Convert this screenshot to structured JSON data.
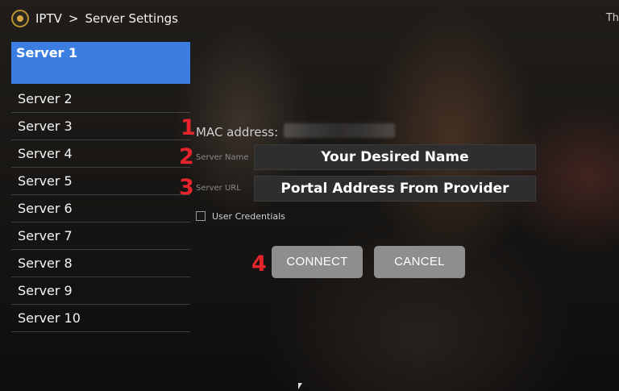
{
  "breadcrumb": {
    "app": "IPTV",
    "separator": ">",
    "page": "Server Settings"
  },
  "corner_text": "Th",
  "servers": [
    "Server 1",
    "Server 2",
    "Server 3",
    "Server 4",
    "Server 5",
    "Server 6",
    "Server 7",
    "Server 8",
    "Server 9",
    "Server 10"
  ],
  "selected_server": "Server 1",
  "steps": [
    "1",
    "2",
    "3",
    "4"
  ],
  "mac": {
    "label": "MAC address:",
    "value": ""
  },
  "form": {
    "server_name_label": "Server Name",
    "server_name_value": "Your Desired Name",
    "server_url_label": "Server URL",
    "server_url_value": "Portal Address From Provider",
    "credentials_label": "User Credentials",
    "credentials_checked": false
  },
  "buttons": {
    "connect": "CONNECT",
    "cancel": "CANCEL"
  },
  "colors": {
    "selection": "#3b7de0",
    "annotation": "#e5242b",
    "button": "#8e8e8e"
  },
  "icons": {
    "logo": "app-logo-icon",
    "cursor": "mouse-cursor-icon"
  }
}
